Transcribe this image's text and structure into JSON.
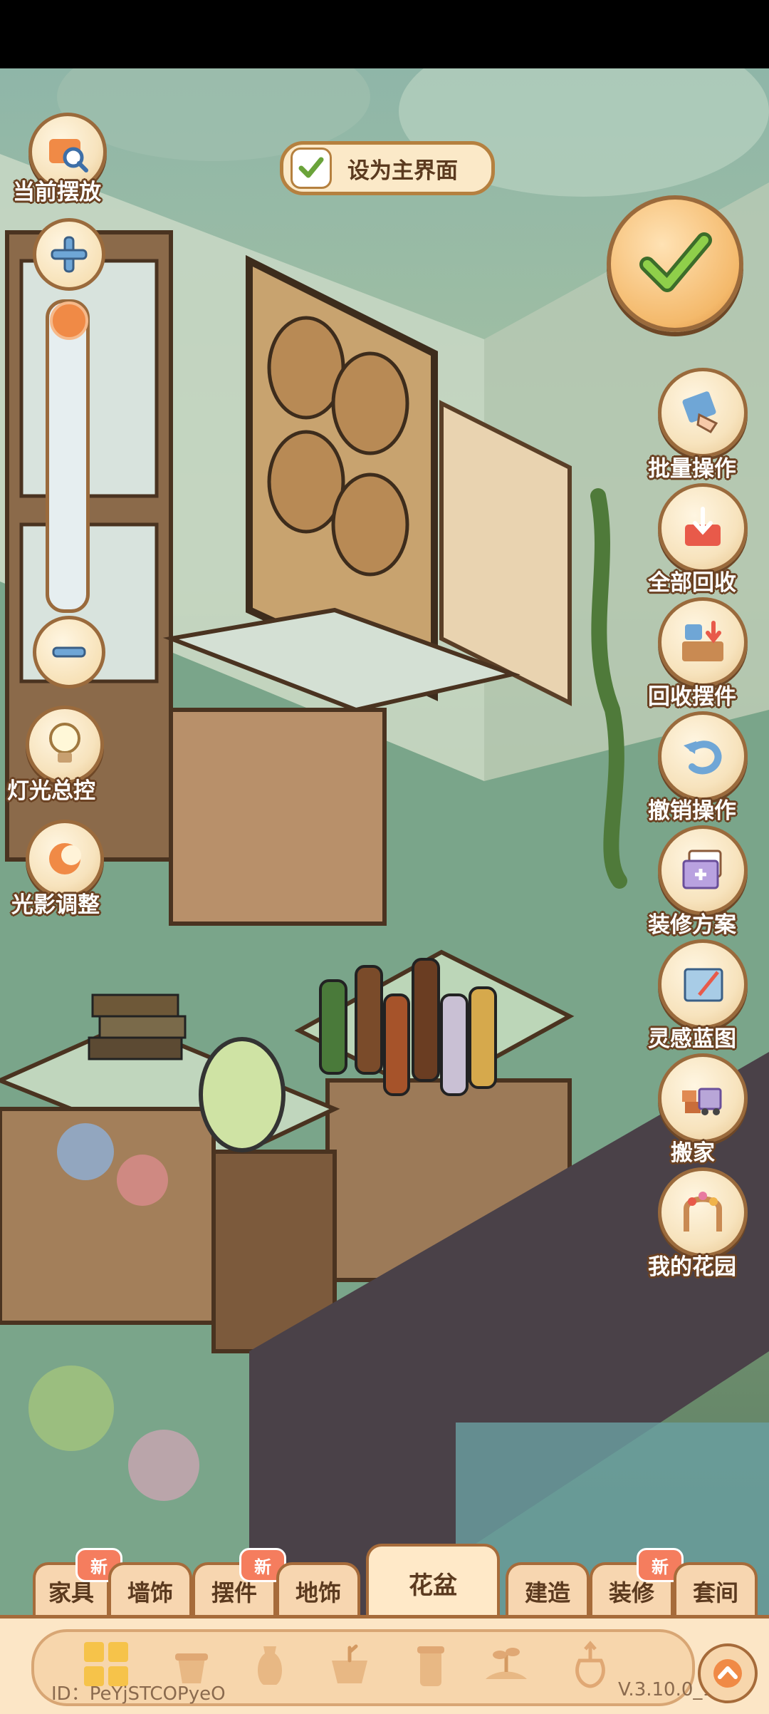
{
  "top_toggle": {
    "label": "设为主界面",
    "checked": true
  },
  "left_controls": {
    "current_placement": "当前摆放",
    "light_control": "灯光总控",
    "shadow_adjust": "光影调整",
    "zoom_level": 0.97
  },
  "right_menu": [
    {
      "label": "批量操作",
      "icon": "hand-swipe-icon"
    },
    {
      "label": "全部回收",
      "icon": "recycle-tray-icon"
    },
    {
      "label": "回收摆件",
      "icon": "recycle-box-icon"
    },
    {
      "label": "撤销操作",
      "icon": "undo-icon"
    },
    {
      "label": "装修方案",
      "icon": "layout-plan-icon"
    },
    {
      "label": "灵感蓝图",
      "icon": "blueprint-icon"
    },
    {
      "label": "搬家",
      "icon": "moving-truck-icon"
    },
    {
      "label": "我的花园",
      "icon": "garden-arch-icon"
    }
  ],
  "tabs": [
    {
      "label": "家具",
      "new": true
    },
    {
      "label": "墙饰",
      "new": false
    },
    {
      "label": "摆件",
      "new": true
    },
    {
      "label": "地饰",
      "new": false
    },
    {
      "label": "花盆",
      "new": false,
      "active": true
    },
    {
      "label": "建造",
      "new": false
    },
    {
      "label": "装修",
      "new": true
    },
    {
      "label": "套间",
      "new": false
    }
  ],
  "new_badge": "新",
  "footer": {
    "id": "ID：PeYjSTCOPyeO",
    "version": "V.3.10.0_13"
  },
  "categories": [
    "grid-icon",
    "pot-icon",
    "vase-icon",
    "planter-icon",
    "tall-pot-icon",
    "sprout-icon",
    "bulb-icon"
  ],
  "colors": {
    "accent": "#f08a46",
    "border": "#9a6a3c",
    "tab_bg": "#f7d6b0",
    "badge": "#f57d5e"
  }
}
